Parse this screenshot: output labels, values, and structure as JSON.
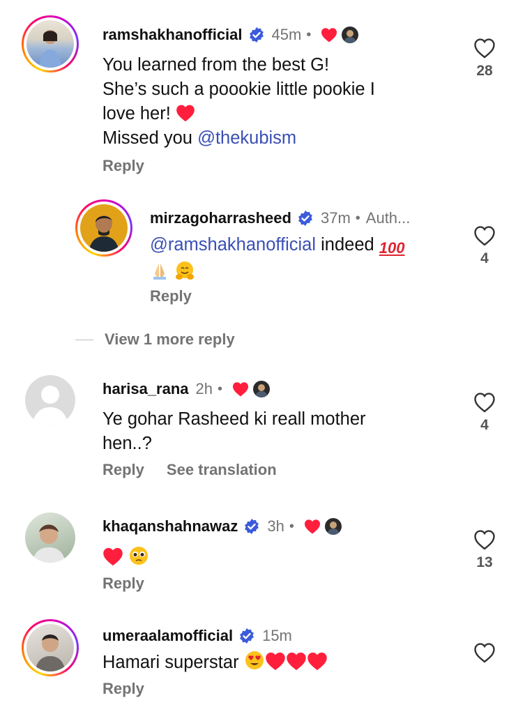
{
  "colors": {
    "accent": "#3a4fb5",
    "muted": "#737373",
    "like_heart": "#ff1f3d",
    "verified": "#3b5bdb"
  },
  "comments": [
    {
      "username": "ramshakhanofficial",
      "verified": true,
      "time": "45m",
      "dot": "•",
      "body_lines": [
        "You learned from the best G!",
        "She’s such a poookie little pookie I",
        "love her! ",
        "Missed you "
      ],
      "body_emoji": "red-heart-emoji",
      "mention": "@thekubism",
      "reply": "Reply",
      "likes": "28",
      "icons": [
        "heart-icon",
        "avatar-icon"
      ]
    },
    {
      "username": "mirzagoharrasheed",
      "verified": true,
      "time": "37m",
      "dot": "•",
      "author": "Auth...",
      "mention": "@ramshakhanofficial",
      "body_text": " indeed ",
      "emojis": [
        "hundred-points-emoji",
        "folded-hands-emoji",
        "hugging-face-emoji"
      ],
      "reply": "Reply",
      "likes": "4"
    },
    {
      "username": "harisa_rana",
      "verified": false,
      "time": "2h",
      "dot": "•",
      "body_lines": [
        "Ye gohar Rasheed ki reall mother",
        "hen..?"
      ],
      "reply": "Reply",
      "see_translation": "See translation",
      "likes": "4"
    },
    {
      "username": "khaqanshahnawaz",
      "verified": true,
      "time": "3h",
      "dot": "•",
      "emojis": [
        "red-heart-emoji",
        "pleading-face-emoji"
      ],
      "reply": "Reply",
      "likes": "13"
    },
    {
      "username": "umeraalamofficial",
      "verified": true,
      "time": "15m",
      "body_text": "Hamari superstar ",
      "emojis": [
        "heart-eyes-emoji",
        "red-heart-emoji",
        "red-heart-emoji",
        "red-heart-emoji"
      ],
      "reply": "Reply"
    }
  ],
  "view_more": "View 1 more reply"
}
